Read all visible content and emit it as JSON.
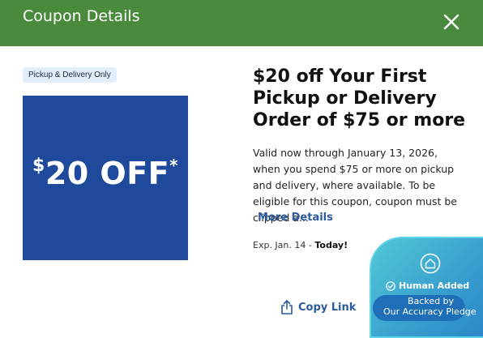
{
  "header": {
    "title": "Coupon Details",
    "close_icon": "close-icon",
    "background_color": "#4a8a3c"
  },
  "coupon": {
    "badge": "Pickup & Delivery Only",
    "image_text": {
      "dollar": "$",
      "amount": "20 OFF",
      "asterisk": "*"
    },
    "image_background": "#1f4a9c",
    "title": "$20 off Your First Pickup or Delivery Order of $75 or more",
    "description": "Valid now through January 13, 2026, when you spend $75 or more on pickup and delivery, where available. To be eligible for this coupon, coupon must be clipped a...",
    "more_details_label": "More Details",
    "expiry_prefix": "Exp. Jan. 14 - ",
    "expiry_emphasis": "Today!"
  },
  "actions": {
    "copy_link_label": "Copy Link",
    "copy_link_icon": "share-icon"
  },
  "pledge": {
    "icon": "home-shield-icon",
    "human_added_icon": "check-circle-icon",
    "human_added": "Human Added",
    "backed_line1": "Backed by",
    "backed_line2": "Our Accuracy Pledge"
  }
}
